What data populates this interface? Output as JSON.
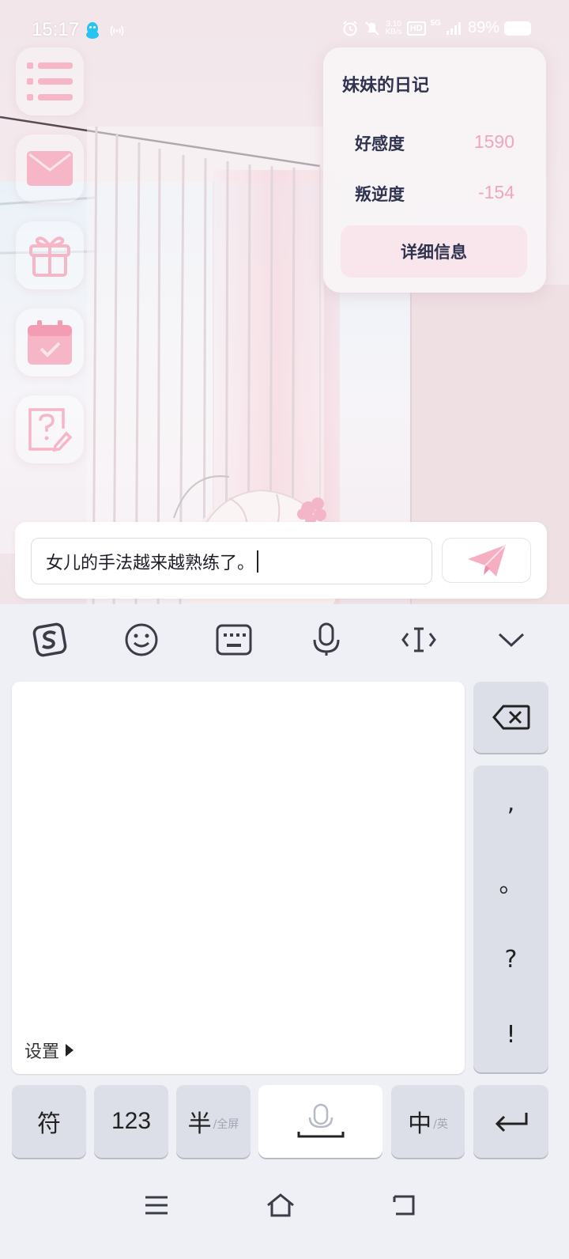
{
  "status_bar": {
    "time": "15:17",
    "net_speed_value": "3.10",
    "net_speed_unit": "KB/s",
    "hd_label": "HD",
    "network_label": "5G",
    "battery_percent": "89%"
  },
  "sidebar": {
    "items": [
      {
        "name": "menu-button",
        "icon": "list-icon"
      },
      {
        "name": "mail-button",
        "icon": "envelope-icon"
      },
      {
        "name": "gift-button",
        "icon": "gift-icon"
      },
      {
        "name": "calendar-button",
        "icon": "calendar-check-icon"
      },
      {
        "name": "quiz-button",
        "icon": "question-edit-icon"
      }
    ]
  },
  "diary": {
    "title": "妹妹的日记",
    "affection_label": "好感度",
    "affection_value": "1590",
    "rebellion_label": "叛逆度",
    "rebellion_value": "-154",
    "detail_button": "详细信息"
  },
  "composer": {
    "input_value": "女儿的手法越来越熟练了。",
    "send_icon": "paper-plane-icon"
  },
  "keyboard": {
    "toolbar": [
      {
        "name": "sogou-logo-icon"
      },
      {
        "name": "emoji-icon"
      },
      {
        "name": "keyboard-icon"
      },
      {
        "name": "microphone-icon"
      },
      {
        "name": "cursor-move-icon"
      },
      {
        "name": "collapse-chevron-icon"
      }
    ],
    "settings_label": "设置",
    "punctuation": [
      ",",
      "。",
      "?",
      "!"
    ],
    "bottom_row": {
      "symbols": "符",
      "numbers": "123",
      "half_main": "半",
      "half_sub": "/全屏",
      "lang_main": "中",
      "lang_sub": "/英"
    }
  },
  "colors": {
    "accent_pink": "#f2a6bc",
    "text_dark": "#2f3350",
    "key_gray": "#dcdfe7",
    "keyboard_bg": "#eef0f5"
  }
}
